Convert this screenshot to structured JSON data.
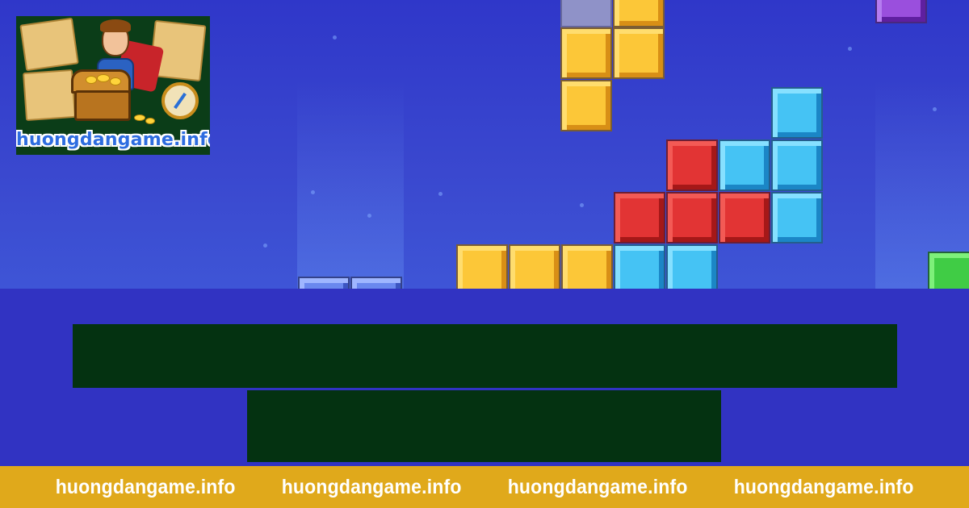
{
  "logo": {
    "text": "huongdangame.info"
  },
  "board": {
    "colors": {
      "yellow": "#f6b72a",
      "red": "#d92a2a",
      "cyan": "#38b8ef",
      "purple": "#8a3fcf",
      "green": "#34c03a",
      "blue": "#5c7be8",
      "background": "#3133c2"
    }
  },
  "title_boxes": {
    "color": "#043211"
  },
  "footer": {
    "background": "#e0a91b",
    "items": [
      "huongdangame.info",
      "huongdangame.info",
      "huongdangame.info",
      "huongdangame.info"
    ]
  }
}
